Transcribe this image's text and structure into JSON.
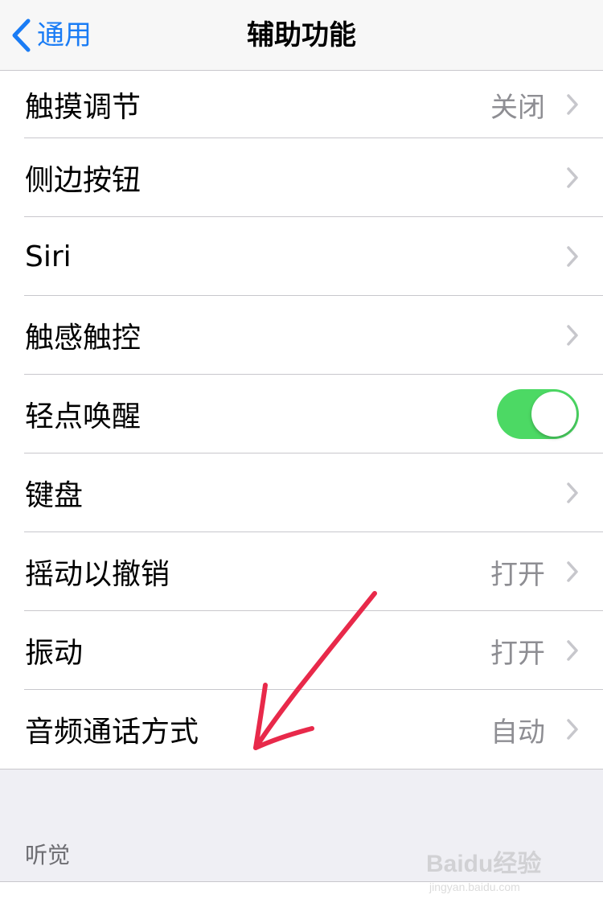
{
  "nav": {
    "back_label": "通用",
    "title": "辅助功能"
  },
  "rows": [
    {
      "label": "触摸调节",
      "value": "关闭",
      "control": "chevron"
    },
    {
      "label": "侧边按钮",
      "value": "",
      "control": "chevron"
    },
    {
      "label": "Siri",
      "value": "",
      "control": "chevron"
    },
    {
      "label": "触感触控",
      "value": "",
      "control": "chevron"
    },
    {
      "label": "轻点唤醒",
      "value": "",
      "control": "toggle",
      "toggle_on": true
    },
    {
      "label": "键盘",
      "value": "",
      "control": "chevron"
    },
    {
      "label": "摇动以撤销",
      "value": "打开",
      "control": "chevron"
    },
    {
      "label": "振动",
      "value": "打开",
      "control": "chevron"
    },
    {
      "label": "音频通话方式",
      "value": "自动",
      "control": "chevron"
    }
  ],
  "section": {
    "header": "听觉"
  },
  "colors": {
    "accent": "#1a7cf5",
    "toggle_on": "#4cd964",
    "annotation_arrow": "#e8294a",
    "secondary_text": "#8e8e93"
  },
  "watermark": {
    "brand": "Baidu经验",
    "url": "jingyan.baidu.com"
  },
  "icons": {
    "back": "chevron-left-icon",
    "disclosure": "chevron-right-icon"
  }
}
